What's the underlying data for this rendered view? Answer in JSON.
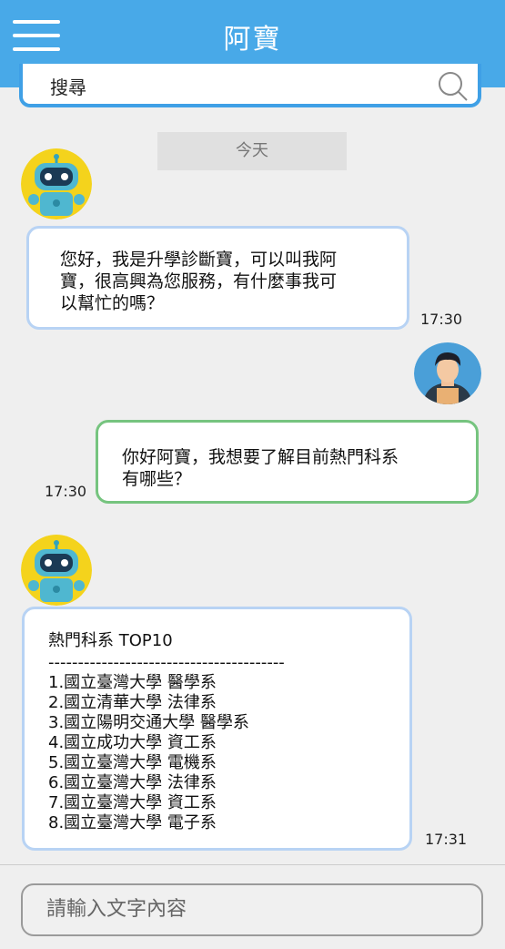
{
  "header": {
    "title": "阿寶",
    "menu_icon": "hamburger-menu-icon"
  },
  "search": {
    "placeholder": "搜尋",
    "icon": "search-icon"
  },
  "chat": {
    "date_label": "今天",
    "messages": [
      {
        "sender": "bot",
        "avatar": "robot-avatar",
        "lines": [
          "您好，我是升學診斷寶，可以叫我阿",
          "寶，很高興為您服務，有什麼事我可",
          "以幫忙的嗎？"
        ],
        "time": "17:30"
      },
      {
        "sender": "user",
        "avatar": "user-avatar",
        "lines": [
          "你好阿寶，我想要了解目前熱門科系",
          "有哪些？"
        ],
        "time": "17:30"
      },
      {
        "sender": "bot",
        "avatar": "robot-avatar",
        "heading": "熱門科系 TOP10",
        "separator": "----------------------------------------",
        "items": [
          "1.國立臺灣大學 醫學系",
          "2.國立清華大學 法律系",
          "3.國立陽明交通大學 醫學系",
          "4.國立成功大學 資工系",
          "5.國立臺灣大學 電機系",
          "6.國立臺灣大學 法律系",
          "7.國立臺灣大學 資工系",
          "8.國立臺灣大學 電子系"
        ],
        "time": "17:31"
      }
    ]
  },
  "composer": {
    "placeholder": "請輸入文字內容"
  },
  "colors": {
    "header": "#48a9e8",
    "bot_bubble_border": "#b8d3f4",
    "user_bubble_border": "#76c47f",
    "background": "#efefef"
  }
}
